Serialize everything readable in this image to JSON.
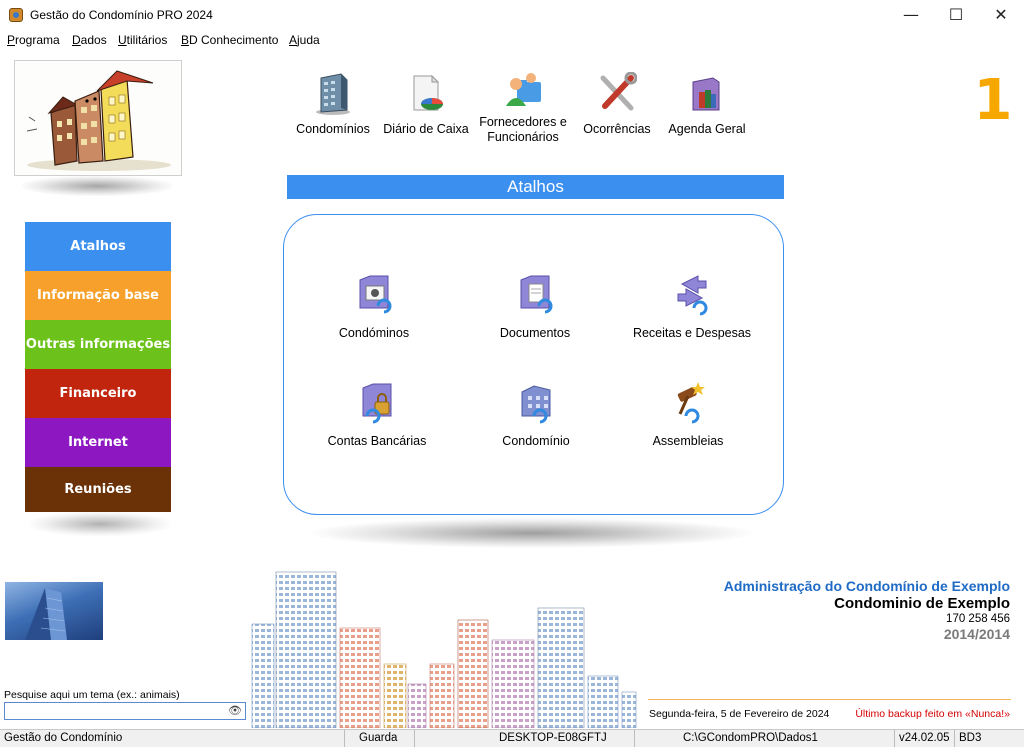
{
  "window": {
    "title": "Gestão do Condomínio PRO 2024"
  },
  "window_controls": {
    "minimize": "—",
    "maximize": "☐",
    "close": "✕"
  },
  "menu": [
    {
      "first": "P",
      "rest": "rograma"
    },
    {
      "first": "D",
      "rest": "ados"
    },
    {
      "first": "U",
      "rest": "tilitários"
    },
    {
      "first": "B",
      "rest": "D Conhecimento"
    },
    {
      "first": "A",
      "rest": "juda"
    }
  ],
  "toolbar": {
    "condominios": "Condomínios",
    "diario": "Diário de Caixa",
    "fornecedores_line1": "Fornecedores e",
    "fornecedores_line2": "Funcionários",
    "ocorrencias": "Ocorrências",
    "agenda": "Agenda Geral"
  },
  "big_number": "1",
  "nav": [
    {
      "label": "Atalhos",
      "color": "#3b8fef"
    },
    {
      "label": "Informação base",
      "color": "#f7a12c"
    },
    {
      "label": "Outras informações",
      "color": "#6cc21a"
    },
    {
      "label": "Financeiro",
      "color": "#c1250e"
    },
    {
      "label": "Internet",
      "color": "#8d18c2"
    },
    {
      "label": "Reuniões",
      "color": "#6b3208"
    }
  ],
  "panel": {
    "title": "Atalhos",
    "shortcuts": {
      "condominos": "Condóminos",
      "documentos": "Documentos",
      "receitas": "Receitas e Despesas",
      "contas": "Contas Bancárias",
      "condominio": "Condomínio",
      "assembleias": "Assembleias"
    }
  },
  "search": {
    "label": "Pesquise aqui um tema (ex.: animais)",
    "value": "",
    "placeholder": ""
  },
  "info": {
    "admin": "Administração do Condomínio de Exemplo",
    "condo": "Condominio de Exemplo",
    "phone": "170 258 456",
    "years": "2014/2014",
    "date": "Segunda-feira, 5 de Fevereiro de 2024",
    "backup": "Último backup feito em  «Nunca!»"
  },
  "status": {
    "app": "Gestão do Condomínio",
    "mode": "Guarda",
    "computer": "DESKTOP-E08GFTJ",
    "path": "C:\\GCondomPRO\\Dados1",
    "version": "v24.02.05",
    "db": "BD3"
  },
  "colors": {
    "accent_blue": "#3b8fef",
    "admin_blue": "#1f6bc5",
    "big_number_orange": "#f6a800",
    "backup_red": "#d40000"
  }
}
